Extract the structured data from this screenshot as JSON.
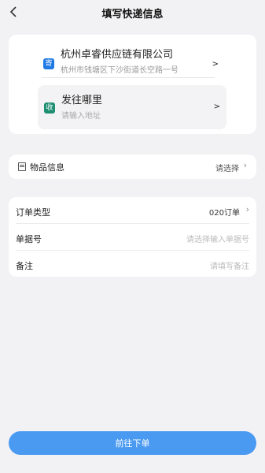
{
  "header": {
    "title": "填写快递信息",
    "back_icon": "chevron-left-icon"
  },
  "sender": {
    "badge": "寄",
    "badge_color": "#1f7ae6",
    "name": "杭州卓睿供应链有限公司",
    "address": "杭州市钱塘区下沙街道长空路一号",
    "arrow": ">"
  },
  "receiver": {
    "badge": "收",
    "badge_color": "#1f8f73",
    "title": "发往哪里",
    "placeholder": "请输入地址",
    "arrow": ">"
  },
  "goods": {
    "label": "物品信息",
    "value": "请选择",
    "chevron": "›"
  },
  "order": {
    "type_label": "订单类型",
    "type_value": "020订单",
    "type_chevron": "›",
    "doc_label": "单据号",
    "doc_placeholder": "请选择输入单据号",
    "remark_label": "备注",
    "remark_placeholder": "请填写备注"
  },
  "submit": {
    "label": "前往下单",
    "color": "#4a9af2"
  }
}
